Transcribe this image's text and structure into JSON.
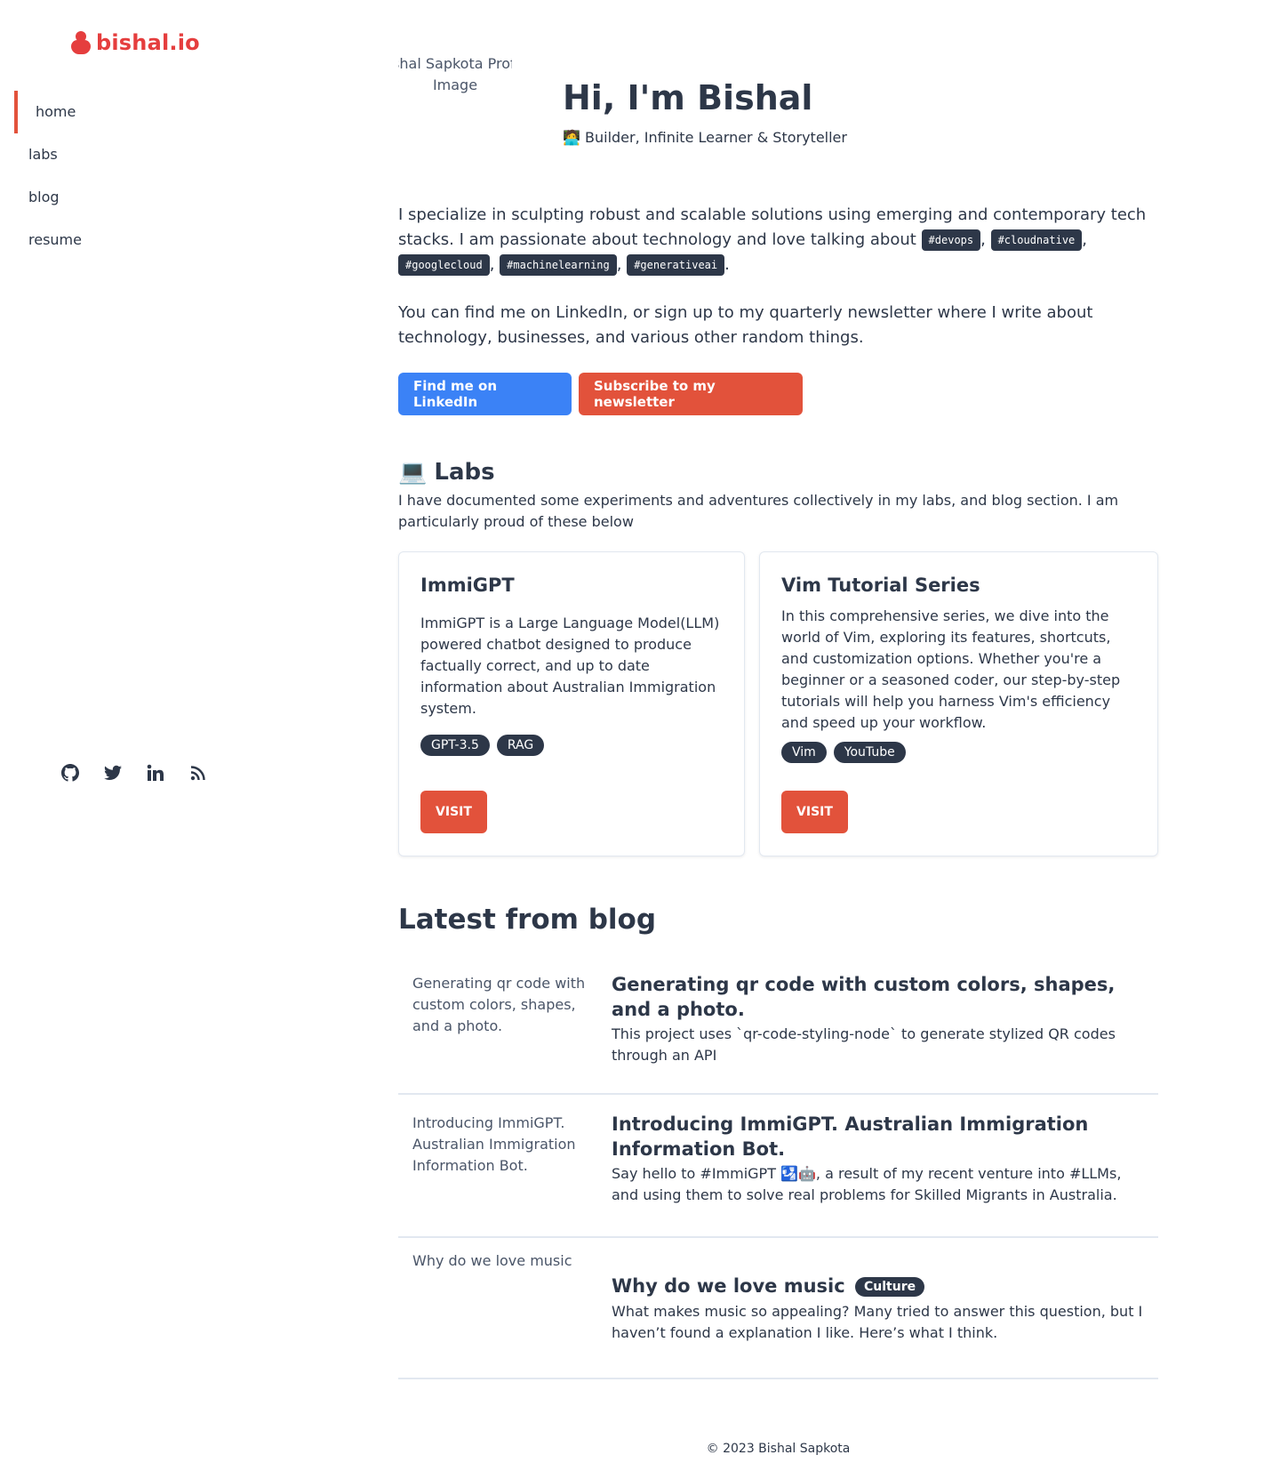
{
  "brand": {
    "name": "bishal.io",
    "color": "#e53e3e"
  },
  "nav": {
    "items": [
      {
        "label": "home",
        "active": true
      },
      {
        "label": "labs"
      },
      {
        "label": "blog"
      },
      {
        "label": "resume"
      }
    ]
  },
  "socials": [
    "github-icon",
    "twitter-icon",
    "linkedin-icon",
    "rss-icon"
  ],
  "hero": {
    "profile_alt": "Bishal Sapkota Profile Image",
    "title": "Hi, I'm Bishal",
    "subtitle": "🧑‍💻 Builder, Infinite Learner & Storyteller"
  },
  "intro": {
    "text_a": "I specialize in sculpting robust and scalable solutions using emerging and contemporary tech stacks. I am passionate about technology and love talking about ",
    "tags": [
      "#devops",
      "#cloudnative",
      "#googlecloud",
      "#machinelearning",
      "#generativeai"
    ],
    "find_text": "You can find me on LinkedIn, or sign up to my quarterly newsletter where I write about technology, businesses, and various other random things."
  },
  "buttons": {
    "linkedin": "Find me on LinkedIn",
    "newsletter": "Subscribe to my newsletter"
  },
  "labs": {
    "title": "Labs",
    "emoji": "💻",
    "desc": "I have documented some experiments and adventures collectively in my labs, and blog section. I am particularly proud of these below",
    "cards": [
      {
        "title": "ImmiGPT",
        "desc": "ImmiGPT is a Large Language Model(LLM) powered chatbot designed to produce factually correct, and up to date information about Australian Immigration system.",
        "tags": [
          "GPT-3.5",
          "RAG"
        ],
        "button": "VISIT"
      },
      {
        "title": "Vim Tutorial Series",
        "desc": "In this comprehensive series, we dive into the world of Vim, exploring its features, shortcuts, and customization options. Whether you're a beginner or a seasoned coder, our step-by-step tutorials will help you harness Vim's efficiency and speed up your workflow.",
        "tags": [
          "Vim",
          "YouTube"
        ],
        "button": "VISIT"
      }
    ]
  },
  "blog": {
    "title": "Latest from blog",
    "posts": [
      {
        "img_alt": "Generating qr code with custom colors, shapes, and a photo.",
        "title": "Generating qr code with custom colors, shapes, and a photo.",
        "desc": "This project uses `qr-code-styling-node` to generate stylized QR codes through an API"
      },
      {
        "img_alt": "Introducing ImmiGPT. Australian Immigration Information Bot.",
        "title": "Introducing ImmiGPT. Australian Immigration Information Bot.",
        "desc": "Say hello to #ImmiGPT 🛂🤖, a result of my recent venture into #LLMs, and using them to solve real problems for Skilled Migrants in Australia."
      },
      {
        "img_alt": "Why do we love music",
        "title": "Why do we love music",
        "badge": "Culture",
        "desc": "What makes music so appealing? Many tried to answer this question, but I haven’t found a explanation I like. Here’s what I think."
      }
    ]
  },
  "footer": "© 2023 Bishal Sapkota",
  "colors": {
    "accent": "#e2523b",
    "linkedin": "#3b82f6",
    "dark": "#2d3748"
  }
}
